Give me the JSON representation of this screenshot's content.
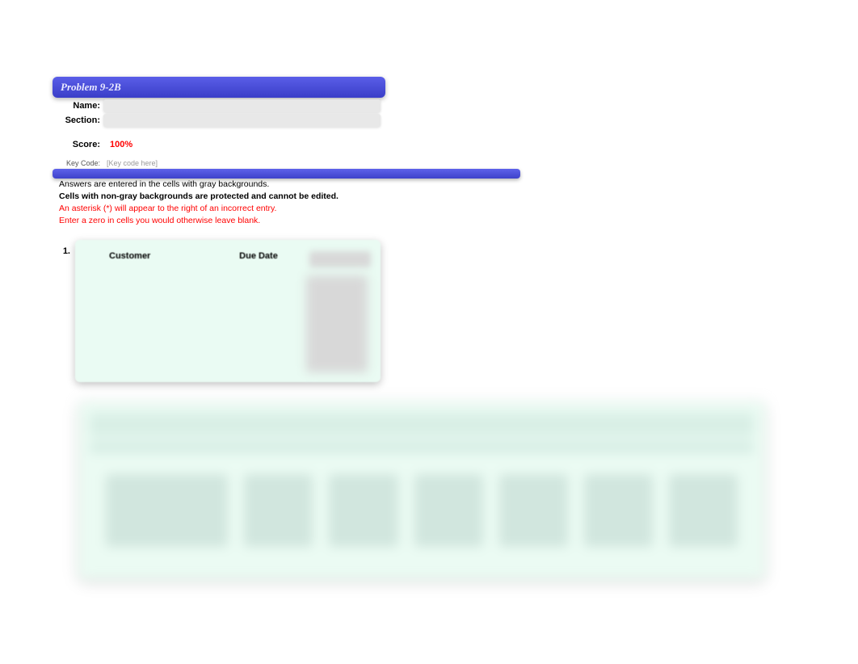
{
  "title": "Problem 9-2B",
  "fields": {
    "name_label": "Name:",
    "name_value": "",
    "section_label": "Section:",
    "section_value": "",
    "score_label": "Score:",
    "score_value": "100%",
    "keycode_label": "Key Code:",
    "keycode_value": "[Key code here]"
  },
  "instructions": {
    "line1": "Answers are entered in the cells with gray backgrounds.",
    "line2": "Cells with non-gray backgrounds are protected and cannot be edited.",
    "line3": "An asterisk (*) will appear to the right of an incorrect entry.",
    "line4": "Enter a zero in cells you would otherwise leave blank."
  },
  "section1": {
    "number": "1.",
    "headers": {
      "customer": "Customer",
      "due_date": "Due Date"
    }
  }
}
